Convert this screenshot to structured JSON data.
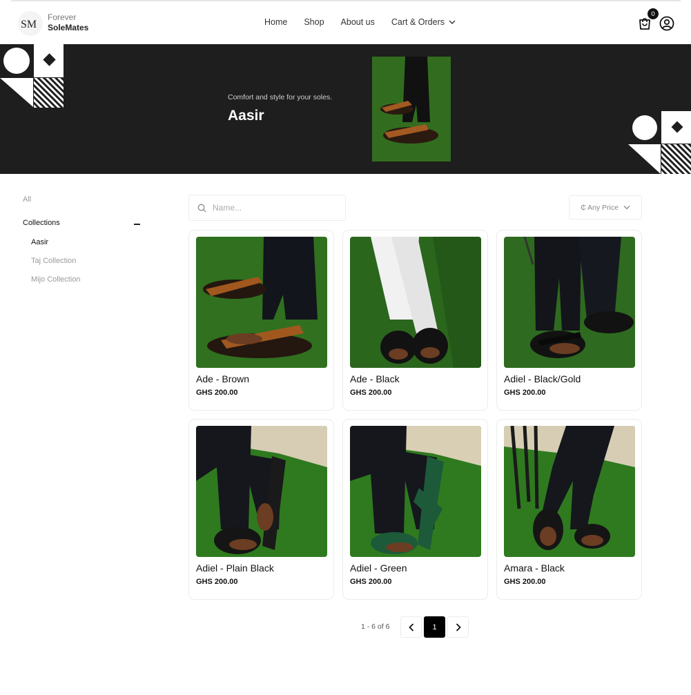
{
  "brand": {
    "line1": "Forever",
    "line2": "SoleMates",
    "logo_icon": "sm-monogram-logo"
  },
  "nav": {
    "items": [
      "Home",
      "Shop",
      "About us",
      "Cart & Orders"
    ],
    "dropdown_icon": "chevron-down-icon"
  },
  "header_icons": {
    "cart_icon": "shopping-bag-icon",
    "cart_count": "0",
    "user_icon": "user-circle-icon"
  },
  "hero": {
    "tagline": "Comfort and style for your soles.",
    "title": "Aasir"
  },
  "sidebar": {
    "all_label": "All",
    "collections_label": "Collections",
    "collections": [
      {
        "label": "Aasir",
        "active": true
      },
      {
        "label": "Taj Collection",
        "active": false
      },
      {
        "label": "Mijo Collection",
        "active": false
      }
    ]
  },
  "search": {
    "placeholder": "Name..."
  },
  "price_filter": {
    "label": "₵ Any Price"
  },
  "products": [
    {
      "name": "Ade - Brown",
      "price": "GHS 200.00",
      "strap_color": "#a0581f"
    },
    {
      "name": "Ade - Black",
      "price": "GHS 200.00",
      "strap_color": "#141414"
    },
    {
      "name": "Adiel - Black/Gold",
      "price": "GHS 200.00",
      "strap_color": "#141414"
    },
    {
      "name": "Adiel - Plain Black",
      "price": "GHS 200.00",
      "strap_color": "#151515"
    },
    {
      "name": "Adiel - Green",
      "price": "GHS 200.00",
      "strap_color": "#1d5a3a"
    },
    {
      "name": "Amara - Black",
      "price": "GHS 200.00",
      "strap_color": "#151515"
    }
  ],
  "pagination": {
    "summary": "1 - 6 of 6",
    "current_page": "1"
  },
  "colors": {
    "hero_bg": "#1e1e1e",
    "grass": "#2e6b1f",
    "accent": "#000000"
  }
}
